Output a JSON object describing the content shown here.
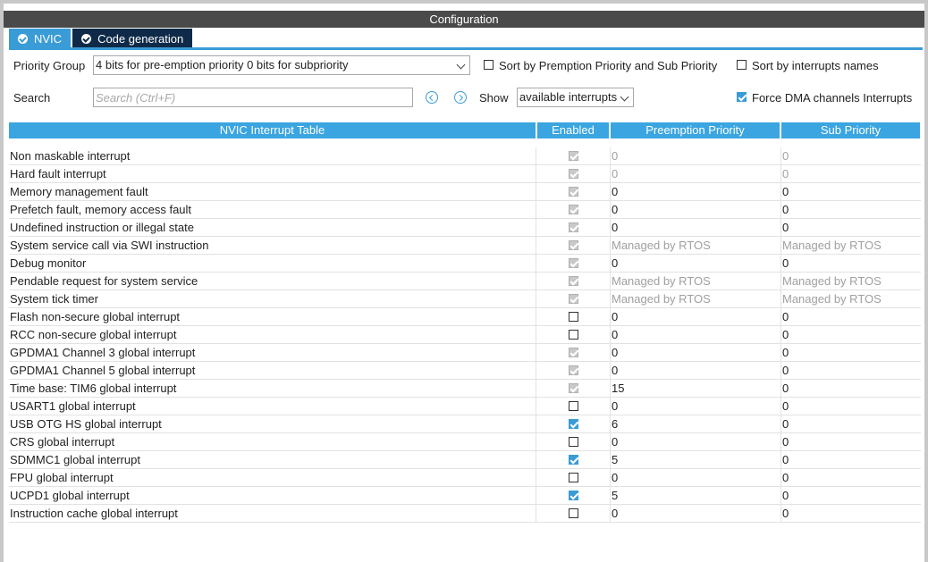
{
  "title": "Configuration",
  "tabs": [
    {
      "label": "NVIC",
      "active": true
    },
    {
      "label": "Code generation",
      "active": false
    }
  ],
  "controls": {
    "priority_group_label": "Priority Group",
    "priority_group_value": "4 bits for pre-emption priority 0 bits for subpriority",
    "sort_premption_label": "Sort by Premption Priority and Sub Priority",
    "sort_premption_checked": false,
    "sort_names_label": "Sort by interrupts names",
    "sort_names_checked": false,
    "search_label": "Search",
    "search_placeholder": "Search (Ctrl+F)",
    "show_label": "Show",
    "show_value": "available interrupts",
    "force_dma_label": "Force DMA channels Interrupts",
    "force_dma_checked": true
  },
  "table": {
    "headers": {
      "name": "NVIC Interrupt Table",
      "enabled": "Enabled",
      "preemption": "Preemption Priority",
      "sub": "Sub Priority"
    },
    "rows": [
      {
        "name": "Non maskable interrupt",
        "enabled": "disabled-checked",
        "pre": "0",
        "sub": "0",
        "pre_gray": true,
        "sub_gray": true
      },
      {
        "name": "Hard fault interrupt",
        "enabled": "disabled-checked",
        "pre": "0",
        "sub": "0",
        "pre_gray": true,
        "sub_gray": true
      },
      {
        "name": "Memory management fault",
        "enabled": "disabled-checked",
        "pre": "0",
        "sub": "0",
        "pre_gray": false,
        "sub_gray": false
      },
      {
        "name": "Prefetch fault, memory access fault",
        "enabled": "disabled-checked",
        "pre": "0",
        "sub": "0",
        "pre_gray": false,
        "sub_gray": false
      },
      {
        "name": "Undefined instruction or illegal state",
        "enabled": "disabled-checked",
        "pre": "0",
        "sub": "0",
        "pre_gray": false,
        "sub_gray": false
      },
      {
        "name": "System service call via SWI instruction",
        "enabled": "disabled-checked",
        "pre": "Managed by RTOS",
        "sub": "Managed by RTOS",
        "pre_gray": true,
        "sub_gray": true
      },
      {
        "name": "Debug monitor",
        "enabled": "disabled-checked",
        "pre": "0",
        "sub": "0",
        "pre_gray": false,
        "sub_gray": false
      },
      {
        "name": "Pendable request for system service",
        "enabled": "disabled-checked",
        "pre": "Managed by RTOS",
        "sub": "Managed by RTOS",
        "pre_gray": true,
        "sub_gray": true
      },
      {
        "name": "System tick timer",
        "enabled": "disabled-checked",
        "pre": "Managed by RTOS",
        "sub": "Managed by RTOS",
        "pre_gray": true,
        "sub_gray": true
      },
      {
        "name": "Flash non-secure global interrupt",
        "enabled": "unchecked",
        "pre": "0",
        "sub": "0",
        "pre_gray": false,
        "sub_gray": false
      },
      {
        "name": "RCC non-secure global interrupt",
        "enabled": "unchecked",
        "pre": "0",
        "sub": "0",
        "pre_gray": false,
        "sub_gray": false
      },
      {
        "name": "GPDMA1 Channel 3 global interrupt",
        "enabled": "disabled-checked",
        "pre": "0",
        "sub": "0",
        "pre_gray": false,
        "sub_gray": false
      },
      {
        "name": "GPDMA1 Channel 5 global interrupt",
        "enabled": "disabled-checked",
        "pre": "0",
        "sub": "0",
        "pre_gray": false,
        "sub_gray": false
      },
      {
        "name": "Time base: TIM6 global interrupt",
        "enabled": "disabled-checked",
        "pre": "15",
        "sub": "0",
        "pre_gray": false,
        "sub_gray": false
      },
      {
        "name": "USART1 global interrupt",
        "enabled": "unchecked",
        "pre": "0",
        "sub": "0",
        "pre_gray": false,
        "sub_gray": false
      },
      {
        "name": "USB OTG HS global interrupt",
        "enabled": "checked",
        "pre": "6",
        "sub": "0",
        "pre_gray": false,
        "sub_gray": false
      },
      {
        "name": "CRS global interrupt",
        "enabled": "unchecked",
        "pre": "0",
        "sub": "0",
        "pre_gray": false,
        "sub_gray": false
      },
      {
        "name": "SDMMC1 global interrupt",
        "enabled": "checked",
        "pre": "5",
        "sub": "0",
        "pre_gray": false,
        "sub_gray": false
      },
      {
        "name": "FPU global interrupt",
        "enabled": "unchecked",
        "pre": "0",
        "sub": "0",
        "pre_gray": false,
        "sub_gray": false
      },
      {
        "name": "UCPD1 global interrupt",
        "enabled": "checked",
        "pre": "5",
        "sub": "0",
        "pre_gray": false,
        "sub_gray": false
      },
      {
        "name": "Instruction cache global interrupt",
        "enabled": "unchecked",
        "pre": "0",
        "sub": "0",
        "pre_gray": false,
        "sub_gray": false
      }
    ]
  },
  "colors": {
    "accent": "#3a9cd6",
    "header": "#3aa5e0",
    "titlebar": "#4a4a4a",
    "tab_inactive": "#0e2a48"
  }
}
